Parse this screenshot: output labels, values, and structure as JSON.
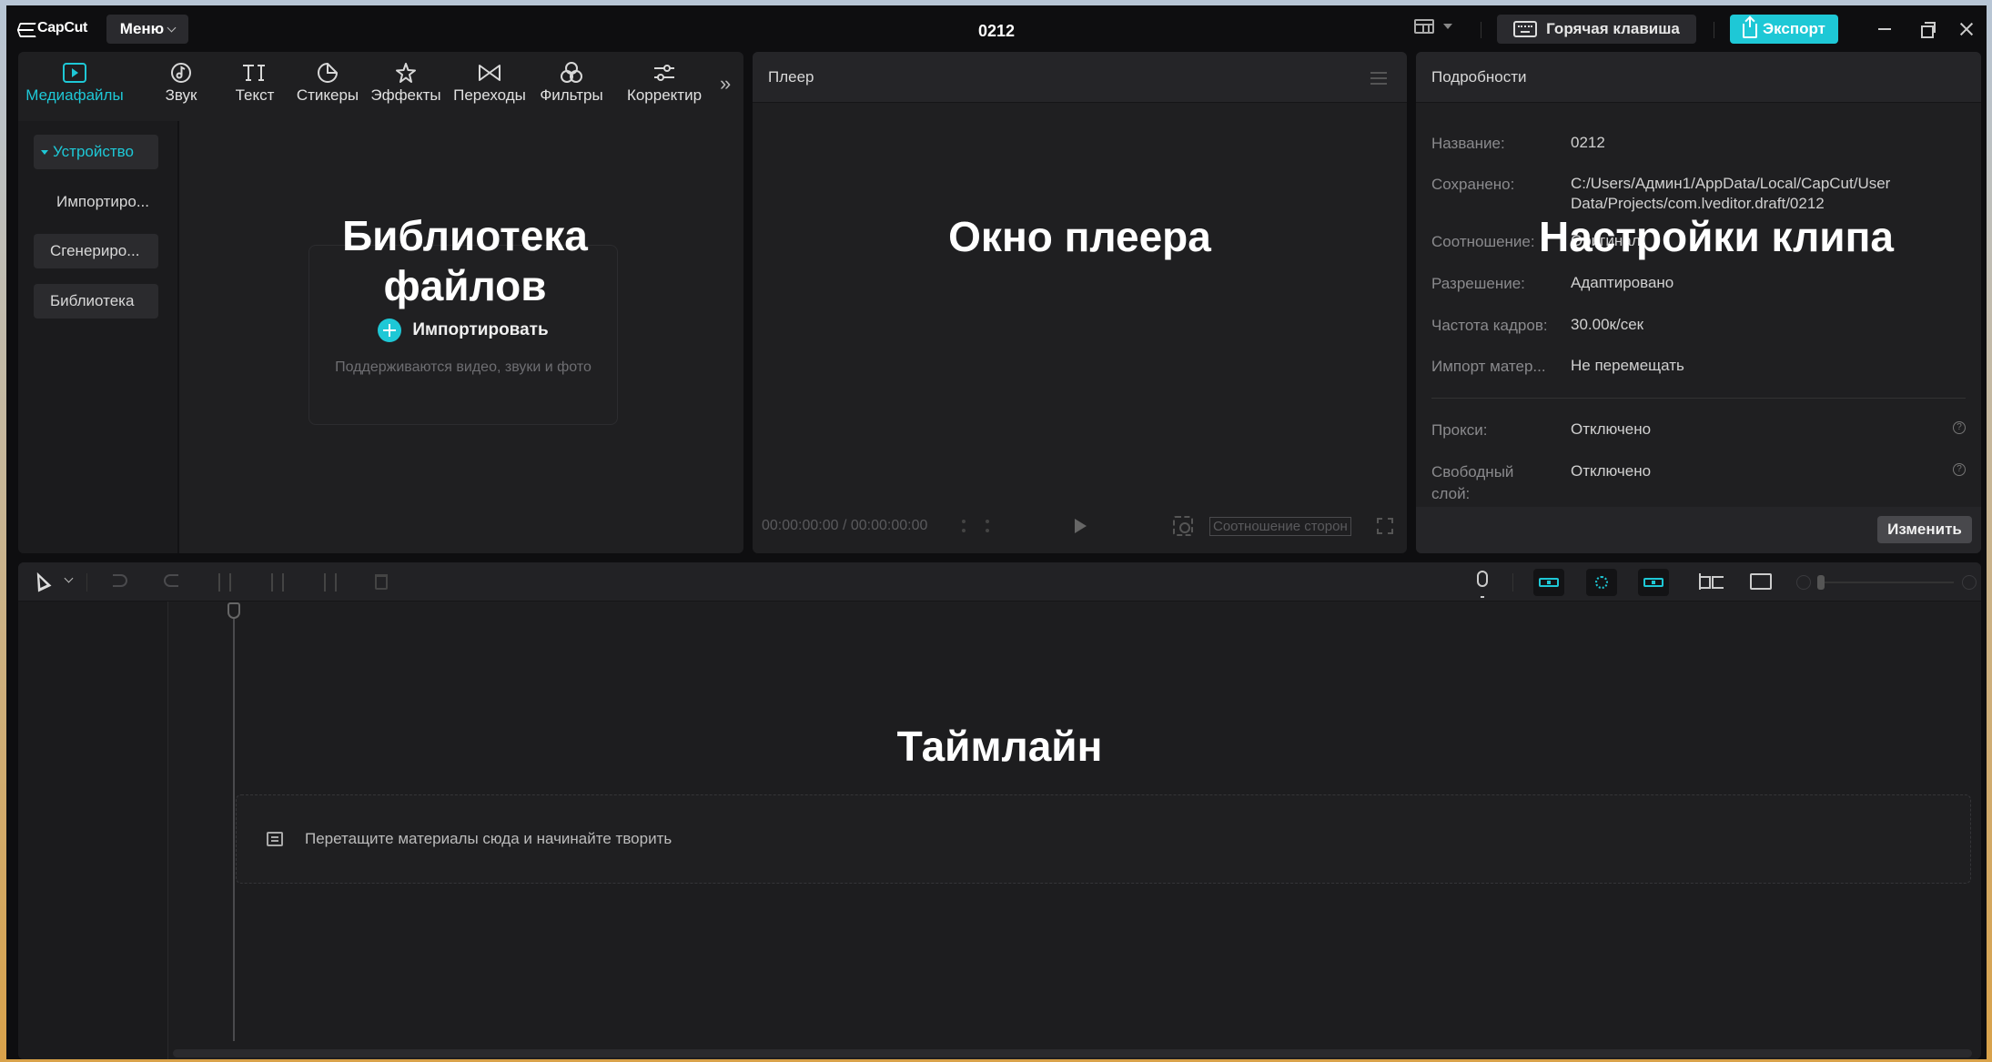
{
  "app": {
    "name": "CapCut",
    "menu_label": "Меню",
    "project_title": "0212"
  },
  "titlebar": {
    "hotkey_label": "Горячая клавиша",
    "export_label": "Экспорт"
  },
  "media": {
    "tabs": [
      {
        "label": "Медиафайлы",
        "icon": "media-icon",
        "active": true
      },
      {
        "label": "Звук",
        "icon": "audio-icon"
      },
      {
        "label": "Текст",
        "icon": "text-icon"
      },
      {
        "label": "Стикеры",
        "icon": "sticker-icon"
      },
      {
        "label": "Эффекты",
        "icon": "effects-icon"
      },
      {
        "label": "Переходы",
        "icon": "transitions-icon"
      },
      {
        "label": "Фильтры",
        "icon": "filters-icon"
      },
      {
        "label": "Корректир",
        "icon": "adjust-icon"
      }
    ],
    "sidebar": [
      "Устройство",
      "Импортиро...",
      "Сгенериро...",
      "Библиотека"
    ],
    "import_label": "Импортировать",
    "import_hint": "Поддерживаются видео, звуки и фото",
    "overlay": "Библиотека файлов"
  },
  "player": {
    "title": "Плеер",
    "timecode": "00:00:00:00 / 00:00:00:00",
    "ratio_label": "Соотношение сторон",
    "overlay": "Окно плеера"
  },
  "details": {
    "title": "Подробности",
    "rows": [
      {
        "key": "Название:",
        "value": "0212"
      },
      {
        "key": "Сохранено:",
        "value": "C:/Users/Админ1/AppData/Local/CapCut/User Data/Projects/com.lveditor.draft/0212"
      },
      {
        "key": "Соотношение:",
        "value": "Оригинал"
      },
      {
        "key": "Разрешение:",
        "value": "Адаптировано"
      },
      {
        "key": "Частота кадров:",
        "value": "30.00к/сек"
      },
      {
        "key": "Импорт матер...",
        "value": "Не перемещать"
      },
      {
        "key": "Прокси:",
        "value": "Отключено"
      },
      {
        "key": "Свободный слой:",
        "value": "Отключено"
      }
    ],
    "change_label": "Изменить",
    "overlay": "Настройки клипа"
  },
  "timeline": {
    "drop_text": "Перетащите материалы сюда и начинайте творить",
    "overlay": "Таймлайн"
  },
  "colors": {
    "accent": "#1ec8d6",
    "panel": "#1f1f21",
    "background": "#0e0e10"
  }
}
